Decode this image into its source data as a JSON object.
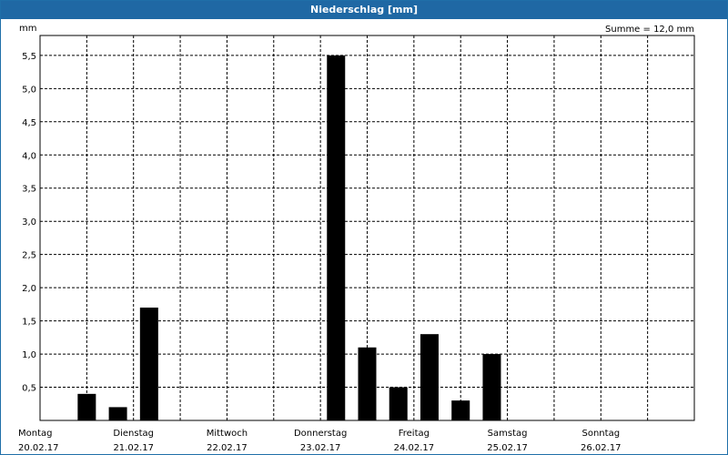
{
  "window": {
    "title": "Niederschlag [mm]"
  },
  "summary": "Summe = 12,0 mm",
  "chart_data": {
    "type": "bar",
    "title": "Niederschlag [mm]",
    "ylabel": "mm",
    "ylim": [
      0,
      5.8
    ],
    "yticks": [
      0.5,
      1.0,
      1.5,
      2.0,
      2.5,
      3.0,
      3.5,
      4.0,
      4.5,
      5.0,
      5.5
    ],
    "ytick_labels": [
      "0,5",
      "1,0",
      "1,5",
      "2,0",
      "2,5",
      "3,0",
      "3,5",
      "4,0",
      "4,5",
      "5,0",
      "5,5"
    ],
    "grid": true,
    "bar_color": "#000000",
    "days": [
      {
        "weekday": "Montag",
        "date": "20.02.17"
      },
      {
        "weekday": "Dienstag",
        "date": "21.02.17"
      },
      {
        "weekday": "Mittwoch",
        "date": "22.02.17"
      },
      {
        "weekday": "Donnerstag",
        "date": "23.02.17"
      },
      {
        "weekday": "Freitag",
        "date": "24.02.17"
      },
      {
        "weekday": "Samstag",
        "date": "25.02.17"
      },
      {
        "weekday": "Sonntag",
        "date": "26.02.17"
      }
    ],
    "bars": [
      {
        "day": 0,
        "hour": 8,
        "value": 0.4
      },
      {
        "day": 0,
        "hour": 16,
        "value": 0.2
      },
      {
        "day": 1,
        "hour": 0,
        "value": 1.7
      },
      {
        "day": 3,
        "hour": 0,
        "value": 5.5
      },
      {
        "day": 3,
        "hour": 8,
        "value": 1.1
      },
      {
        "day": 3,
        "hour": 16,
        "value": 0.5
      },
      {
        "day": 4,
        "hour": 0,
        "value": 1.3
      },
      {
        "day": 4,
        "hour": 8,
        "value": 0.3
      },
      {
        "day": 4,
        "hour": 16,
        "value": 1.0
      }
    ]
  }
}
